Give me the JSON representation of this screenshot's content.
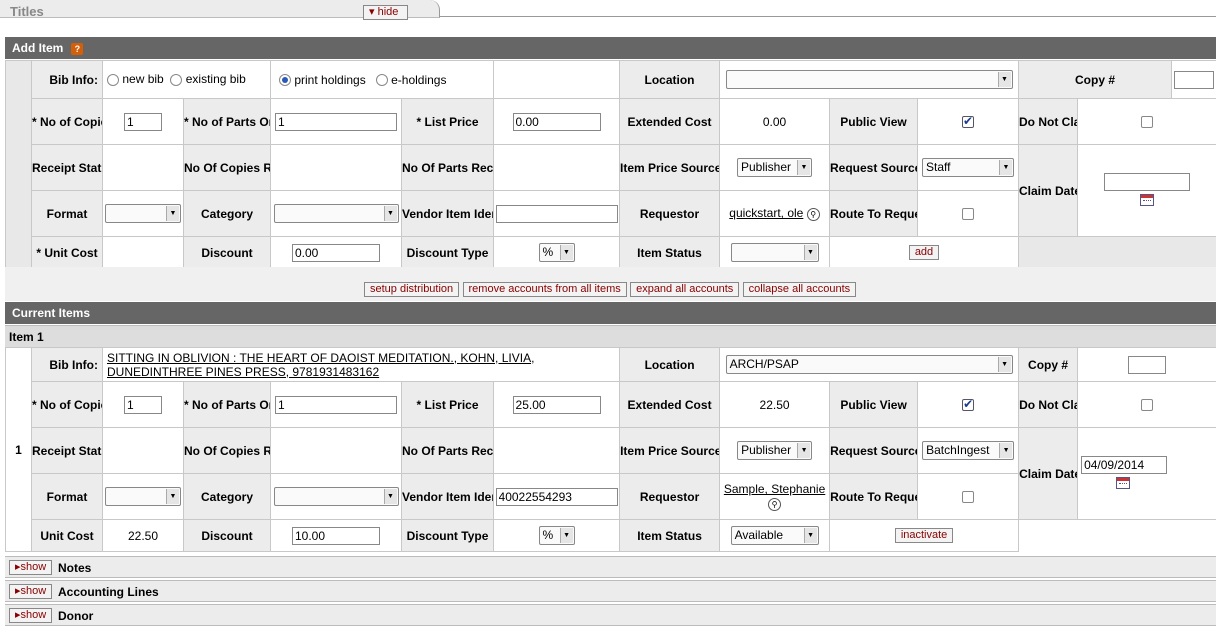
{
  "titles_tab": {
    "title": "Titles",
    "hide_label": "hide"
  },
  "add_item": {
    "header": "Add Item",
    "help_icon": "?",
    "bib_info_label": "Bib Info:",
    "radio_new_bib": "new bib",
    "radio_existing_bib": "existing bib",
    "radio_print_holdings": "print holdings",
    "radio_e_holdings": "e-holdings",
    "location_label": "Location",
    "location_value": "",
    "copy_label": "Copy #",
    "copy_value": "",
    "no_copies_ordered_label": "* No of Copies Ordered",
    "no_copies_ordered_value": "1",
    "no_parts_ordered_label": "* No of Parts Ordered",
    "no_parts_ordered_value": "1",
    "list_price_label": "* List Price",
    "list_price_value": "0.00",
    "extended_cost_label": "Extended Cost",
    "extended_cost_value": "0.00",
    "public_view_label": "Public View",
    "do_not_claim_label": "Do Not Claim",
    "receipt_status_label": "Receipt Status",
    "no_copies_received_label": "No Of Copies Received",
    "no_parts_received_label": "No Of Parts Received",
    "item_price_source_label": "Item Price Source",
    "item_price_source_value": "Publisher",
    "request_source_label": "Request Source",
    "request_source_value": "Staff",
    "claim_date_label": "Claim Date",
    "claim_date_value": "",
    "format_label": "Format",
    "category_label": "Category",
    "vendor_item_id_label": "Vendor Item Identifier",
    "vendor_item_id_value": "",
    "requestor_label": "Requestor",
    "requestor_value": "quickstart, ole",
    "route_to_requestor_label": "Route To Requestor",
    "unit_cost_label": "* Unit Cost",
    "discount_label": "Discount",
    "discount_value": "0.00",
    "discount_type_label": "Discount Type",
    "discount_type_value": "%",
    "item_status_label": "Item Status",
    "item_status_value": "",
    "add_button": "add"
  },
  "actions": {
    "setup_distribution": "setup distribution",
    "remove_accounts": "remove accounts from all items",
    "expand_accounts": "expand all accounts",
    "collapse_accounts": "collapse all accounts"
  },
  "current_items": {
    "header": "Current Items",
    "item_header": "Item 1",
    "row_number": "1",
    "bib_info_label": "Bib Info:",
    "bib_info_value": "SITTING IN OBLIVION : THE HEART OF DAOIST MEDITATION., KOHN, LIVIA, DUNEDINTHREE PINES PRESS, 9781931483162",
    "location_label": "Location",
    "location_value": "ARCH/PSAP",
    "copy_label": "Copy #",
    "copy_value": "",
    "no_copies_ordered_label": "* No of Copies Ordered",
    "no_copies_ordered_value": "1",
    "no_parts_ordered_label": "* No of Parts Ordered",
    "no_parts_ordered_value": "1",
    "list_price_label": "* List Price",
    "list_price_value": "25.00",
    "extended_cost_label": "Extended Cost",
    "extended_cost_value": "22.50",
    "public_view_label": "Public View",
    "do_not_claim_label": "Do Not Claim",
    "receipt_status_label": "Receipt Status",
    "no_copies_received_label": "No Of Copies Received",
    "no_parts_received_label": "No Of Parts Received",
    "item_price_source_label": "Item Price Source",
    "item_price_source_value": "Publisher",
    "request_source_label": "Request Source",
    "request_source_value": "BatchIngest",
    "claim_date_label": "Claim Date",
    "claim_date_value": "04/09/2014",
    "format_label": "Format",
    "category_label": "Category",
    "vendor_item_id_label": "Vendor Item Identifier",
    "vendor_item_id_value": "40022554293",
    "requestor_label": "Requestor",
    "requestor_value": "Sample, Stephanie",
    "route_to_requestor_label": "Route To Requestor",
    "unit_cost_label": "Unit Cost",
    "unit_cost_value": "22.50",
    "discount_label": "Discount",
    "discount_value": "10.00",
    "discount_type_label": "Discount Type",
    "discount_type_value": "%",
    "item_status_label": "Item Status",
    "item_status_value": "Available",
    "inactivate_button": "inactivate"
  },
  "sections": {
    "show_label": "show",
    "notes": "Notes",
    "accounting_lines": "Accounting Lines",
    "donor": "Donor"
  }
}
